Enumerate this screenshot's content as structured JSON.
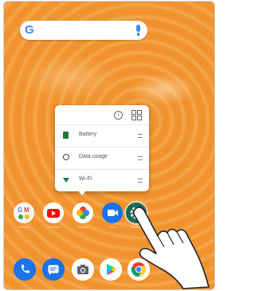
{
  "search_bar": {
    "logo_letter": "G",
    "logo_icon": "google-g-icon",
    "mic_icon": "microphone-icon"
  },
  "shortcut_popup": {
    "header_icons": [
      "info-icon",
      "widgets-icon"
    ],
    "info_glyph": "i",
    "items": [
      {
        "label": "Battery",
        "icon": "battery-icon"
      },
      {
        "label": "Data usage",
        "icon": "data-usage-icon"
      },
      {
        "label": "Wi-Fi",
        "icon": "wifi-icon"
      }
    ]
  },
  "home_row_apps": [
    {
      "icon": "google-apps-folder-icon",
      "label": "Google"
    },
    {
      "icon": "youtube-icon",
      "label": "YouTube"
    },
    {
      "icon": "photos-icon",
      "label": "Photos"
    },
    {
      "icon": "duo-video-icon",
      "label": "Duo"
    },
    {
      "icon": "settings-icon",
      "label": "Settings"
    }
  ],
  "dock_apps": [
    {
      "icon": "phone-icon"
    },
    {
      "icon": "messages-icon"
    },
    {
      "icon": "camera-icon"
    },
    {
      "icon": "play-store-icon"
    },
    {
      "icon": "chrome-icon"
    }
  ],
  "colors": {
    "wallpaper": "#f0922e",
    "popup_bg": "#ffffff",
    "accent_green": "#1a7a3c"
  }
}
